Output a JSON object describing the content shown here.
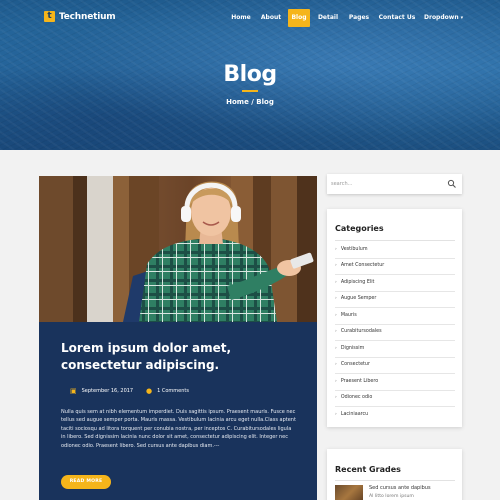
{
  "brand": {
    "logo_letter": "t",
    "name": "Technetium",
    "accent": "#f5b51b",
    "dark_blue": "#19335c"
  },
  "nav": {
    "items": [
      {
        "label": "Home",
        "active": false
      },
      {
        "label": "About",
        "active": false
      },
      {
        "label": "Blog",
        "active": true
      },
      {
        "label": "Detail",
        "active": false
      },
      {
        "label": "Pages",
        "active": false
      },
      {
        "label": "Contact Us",
        "active": false
      },
      {
        "label": "Dropdown",
        "active": false,
        "caret": "▾"
      }
    ]
  },
  "hero": {
    "title": "Blog",
    "breadcrumb": "Home / Blog"
  },
  "post": {
    "title": "Lorem ipsum dolor amet, consectetur adipiscing.",
    "date": "September 16, 2017",
    "comments": "1 Comments",
    "body": "Nulla quis sem at nibh elementum imperdiet. Duis sagittis ipsum. Praesent mauris. Fusce nec tellus sed augue semper porta. Mauris massa. Vestibulum lacinia arcu eget nulla.Class aptent taciti sociosqu ad litora torquent per conubia nostra, per inceptos C. Curabitursodales ligula in libero. Sed dignissim lacinia nunc dolor sit amet, consectetur adipiscing elit. Integer nec odionec odio. Praesent libero. Sed cursus ante dapibus diam.---",
    "read_more": "READ MORE",
    "icons": {
      "date": "calendar-icon",
      "comments": "comment-icon"
    }
  },
  "sidebar": {
    "search": {
      "placeholder": "search...",
      "icon": "search-icon"
    },
    "categories": {
      "title": "Categories",
      "items": [
        "Vestibulum",
        "Amet Consectetur",
        "Adipiscing Elit",
        "Augue Semper",
        "Mauris",
        "Curabitursodales",
        "Dignissim",
        "Consectetur",
        "Praesent Libero",
        "Odionec odio",
        "Laciniaarcu"
      ]
    },
    "recent": {
      "title": "Recent Grades",
      "items": [
        {
          "title": "Sed cursus ante dapibus",
          "subtitle": "Al litto lorem ipsum"
        }
      ]
    }
  }
}
